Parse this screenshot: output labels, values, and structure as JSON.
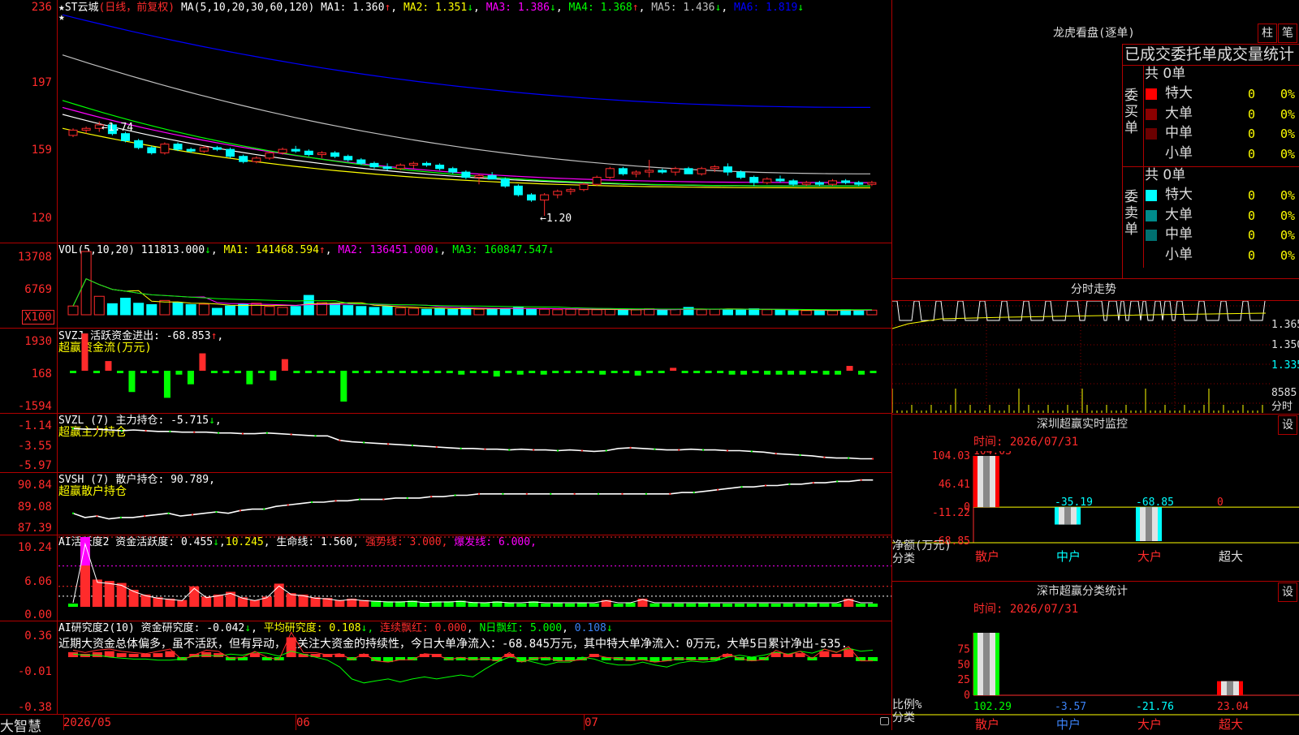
{
  "main": {
    "title": "ST云城",
    "mode": "(日线，前复权)",
    "ma_label": "MA(5,10,20,30,60,120)",
    "ma": [
      {
        "name": "MA1:",
        "value": "1.360",
        "arrow": "↑",
        "color": "#ffffff"
      },
      {
        "name": "MA2:",
        "value": "1.351",
        "arrow": "↓",
        "color": "#ffff00"
      },
      {
        "name": "MA3:",
        "value": "1.386",
        "arrow": "↓",
        "color": "#ff00ff"
      },
      {
        "name": "MA4:",
        "value": "1.368",
        "arrow": "↑",
        "color": "#00ff00"
      },
      {
        "name": "MA5:",
        "value": "1.436",
        "arrow": "↓",
        "color": "#c0c0c0"
      },
      {
        "name": "MA6:",
        "value": "1.819",
        "arrow": "↓",
        "color": "#0000ff"
      }
    ],
    "yticks": [
      "236",
      "197",
      "159",
      "120"
    ],
    "annot_high": "←1.74",
    "annot_low": "←1.20",
    "ohlc": [
      [
        1.66,
        1.7,
        1.65,
        1.69
      ],
      [
        1.69,
        1.71,
        1.67,
        1.7
      ],
      [
        1.7,
        1.74,
        1.68,
        1.72
      ],
      [
        1.72,
        1.73,
        1.66,
        1.67
      ],
      [
        1.67,
        1.68,
        1.62,
        1.63
      ],
      [
        1.63,
        1.64,
        1.58,
        1.59
      ],
      [
        1.59,
        1.6,
        1.55,
        1.56
      ],
      [
        1.56,
        1.62,
        1.55,
        1.61
      ],
      [
        1.61,
        1.62,
        1.57,
        1.58
      ],
      [
        1.58,
        1.59,
        1.56,
        1.57
      ],
      [
        1.57,
        1.6,
        1.56,
        1.59
      ],
      [
        1.59,
        1.6,
        1.57,
        1.58
      ],
      [
        1.58,
        1.59,
        1.53,
        1.54
      ],
      [
        1.54,
        1.55,
        1.5,
        1.51
      ],
      [
        1.51,
        1.54,
        1.5,
        1.53
      ],
      [
        1.53,
        1.57,
        1.52,
        1.56
      ],
      [
        1.56,
        1.59,
        1.55,
        1.58
      ],
      [
        1.58,
        1.6,
        1.56,
        1.57
      ],
      [
        1.57,
        1.58,
        1.54,
        1.55
      ],
      [
        1.55,
        1.57,
        1.53,
        1.56
      ],
      [
        1.56,
        1.57,
        1.53,
        1.54
      ],
      [
        1.54,
        1.55,
        1.51,
        1.52
      ],
      [
        1.52,
        1.53,
        1.49,
        1.5
      ],
      [
        1.5,
        1.51,
        1.47,
        1.48
      ],
      [
        1.48,
        1.5,
        1.46,
        1.47
      ],
      [
        1.47,
        1.5,
        1.46,
        1.49
      ],
      [
        1.49,
        1.51,
        1.47,
        1.5
      ],
      [
        1.5,
        1.51,
        1.48,
        1.49
      ],
      [
        1.49,
        1.5,
        1.46,
        1.47
      ],
      [
        1.47,
        1.48,
        1.44,
        1.45
      ],
      [
        1.45,
        1.46,
        1.41,
        1.42
      ],
      [
        1.42,
        1.44,
        1.38,
        1.43
      ],
      [
        1.43,
        1.45,
        1.41,
        1.41
      ],
      [
        1.41,
        1.42,
        1.36,
        1.37
      ],
      [
        1.37,
        1.38,
        1.31,
        1.32
      ],
      [
        1.32,
        1.33,
        1.28,
        1.29
      ],
      [
        1.29,
        1.33,
        1.2,
        1.32
      ],
      [
        1.32,
        1.35,
        1.3,
        1.34
      ],
      [
        1.34,
        1.36,
        1.32,
        1.35
      ],
      [
        1.35,
        1.39,
        1.34,
        1.38
      ],
      [
        1.38,
        1.43,
        1.37,
        1.42
      ],
      [
        1.42,
        1.48,
        1.41,
        1.47
      ],
      [
        1.47,
        1.48,
        1.43,
        1.44
      ],
      [
        1.44,
        1.46,
        1.42,
        1.45
      ],
      [
        1.45,
        1.52,
        1.42,
        1.46
      ],
      [
        1.46,
        1.47,
        1.44,
        1.45
      ],
      [
        1.45,
        1.48,
        1.43,
        1.47
      ],
      [
        1.47,
        1.48,
        1.44,
        1.44
      ],
      [
        1.44,
        1.48,
        1.43,
        1.47
      ],
      [
        1.47,
        1.49,
        1.45,
        1.48
      ],
      [
        1.48,
        1.5,
        1.43,
        1.45
      ],
      [
        1.45,
        1.46,
        1.41,
        1.42
      ],
      [
        1.42,
        1.43,
        1.37,
        1.39
      ],
      [
        1.39,
        1.42,
        1.38,
        1.41
      ],
      [
        1.41,
        1.43,
        1.39,
        1.4
      ],
      [
        1.4,
        1.41,
        1.37,
        1.38
      ],
      [
        1.38,
        1.4,
        1.37,
        1.39
      ],
      [
        1.39,
        1.4,
        1.37,
        1.38
      ],
      [
        1.38,
        1.41,
        1.37,
        1.4
      ],
      [
        1.4,
        1.41,
        1.38,
        1.39
      ],
      [
        1.39,
        1.4,
        1.37,
        1.38
      ],
      [
        1.38,
        1.4,
        1.37,
        1.39
      ]
    ],
    "ma_lines": [
      {
        "color": "#ffffff",
        "start": 1.78,
        "end": 1.37
      },
      {
        "color": "#ffff00",
        "start": 1.7,
        "end": 1.36
      },
      {
        "color": "#ff00ff",
        "start": 1.82,
        "end": 1.39
      },
      {
        "color": "#00ff00",
        "start": 1.86,
        "end": 1.37
      },
      {
        "color": "#c0c0c0",
        "start": 2.12,
        "end": 1.44
      },
      {
        "color": "#0000ff",
        "start": 2.35,
        "end": 1.82
      }
    ]
  },
  "vol": {
    "label": "VOL(5,10,20)",
    "value": "111813.000",
    "arrow": "↓",
    "ma": [
      {
        "name": "MA1:",
        "value": "141468.594",
        "arrow": "↑",
        "color": "#ffff00"
      },
      {
        "name": "MA2:",
        "value": "136451.000",
        "arrow": "↓",
        "color": "#ff00ff"
      },
      {
        "name": "MA3:",
        "value": "160847.547",
        "arrow": "↓",
        "color": "#00ff00"
      }
    ],
    "yticks": [
      "13708",
      "6769"
    ],
    "unit": "X100",
    "values": [
      1.9,
      13.7,
      4.0,
      2.4,
      3.6,
      2.5,
      2.2,
      3.1,
      2.6,
      2.2,
      2.3,
      1.4,
      1.9,
      2.3,
      2.5,
      1.8,
      1.6,
      1.8,
      4.2,
      2.6,
      2.4,
      2.0,
      1.8,
      1.6,
      1.8,
      1.5,
      1.4,
      1.2,
      1.3,
      1.2,
      1.5,
      1.2,
      1.3,
      1.4,
      1.6,
      1.3,
      1.2,
      1.1,
      1.2,
      1.1,
      1.1,
      1.2,
      1.0,
      1.1,
      1.3,
      1.0,
      1.2,
      1.6,
      1.1,
      1.2,
      1.2,
      1.1,
      1.3,
      1.1,
      1.0,
      0.9,
      0.9,
      1.0,
      0.9,
      1.1,
      1.0,
      1.0
    ]
  },
  "svzj": {
    "label": "SVZJ  活跃资金进出:",
    "value": "-68.853",
    "arrow": "↑",
    "subtitle": "超赢资金流(万元)",
    "yticks": [
      "1930",
      "168",
      "-1594"
    ],
    "values": [
      -30,
      1930,
      -60,
      500,
      -100,
      -1100,
      -80,
      -120,
      -1400,
      -200,
      -700,
      900,
      -100,
      -50,
      -100,
      -700,
      -60,
      -500,
      600,
      -80,
      -120,
      -60,
      -50,
      -1594,
      -60,
      -50,
      -60,
      -80,
      -40,
      -60,
      -50,
      -40,
      -80,
      -200,
      -40,
      -60,
      -300,
      -60,
      -200,
      -50,
      -200,
      -40,
      -40,
      -50,
      -40,
      -200,
      -30,
      -40,
      -250,
      -30,
      -40,
      150,
      -60,
      -40,
      -40,
      -40,
      -200,
      -200,
      -30,
      -200,
      -200,
      -200,
      -200,
      -30,
      -200,
      -200,
      250,
      -200,
      -50
    ]
  },
  "svzl": {
    "label": "SVZL (7) 主力持仓:",
    "value": "-5.715",
    "arrow": "↓",
    "subtitle": "超赢主力持仓",
    "yticks": [
      "-1.14",
      "-3.55",
      "-5.97"
    ],
    "series": [
      -1.6,
      -1.7,
      -1.7,
      -1.8,
      -1.9,
      -1.8,
      -1.9,
      -2.0,
      -2.0,
      -2.1,
      -2.1,
      -2.1,
      -2.2,
      -2.2,
      -2.3,
      -2.3,
      -2.2,
      -2.3,
      -2.4,
      -2.5,
      -2.6,
      -2.6,
      -3.2,
      -3.4,
      -3.5,
      -3.6,
      -3.7,
      -3.8,
      -3.9,
      -4.0,
      -4.1,
      -4.2,
      -4.3,
      -4.3,
      -4.4,
      -4.4,
      -4.5,
      -4.4,
      -4.5,
      -4.5,
      -4.6,
      -4.5,
      -4.6,
      -4.7,
      -4.6,
      -4.3,
      -4.2,
      -4.3,
      -4.4,
      -4.5,
      -4.5,
      -4.4,
      -4.5,
      -4.5,
      -4.6,
      -4.6,
      -4.7,
      -4.8,
      -5.0,
      -5.1,
      -5.2,
      -5.3,
      -5.5,
      -5.6,
      -5.6,
      -5.7,
      -5.7
    ]
  },
  "svsh": {
    "label": "SVSH (7) 散户持仓:",
    "value": "90.789",
    "arrow": "",
    "subtitle": "超赢散户持仓",
    "yticks": [
      "90.84",
      "89.08",
      "87.39"
    ],
    "series": [
      88.4,
      88.1,
      88.2,
      88.0,
      88.1,
      88.1,
      88.2,
      88.3,
      88.4,
      88.2,
      88.3,
      88.4,
      88.5,
      88.4,
      88.6,
      88.7,
      88.7,
      88.9,
      89.0,
      89.1,
      89.2,
      89.2,
      89.3,
      89.3,
      89.4,
      89.4,
      89.4,
      89.5,
      89.5,
      89.5,
      89.6,
      89.6,
      89.7,
      89.7,
      89.8,
      89.8,
      89.8,
      89.8,
      89.8,
      89.8,
      89.8,
      89.8,
      89.8,
      89.8,
      89.8,
      89.8,
      89.8,
      89.8,
      89.8,
      89.8,
      89.8,
      89.9,
      89.9,
      90.0,
      90.1,
      90.2,
      90.3,
      90.3,
      90.4,
      90.4,
      90.5,
      90.5,
      90.6,
      90.6,
      90.7,
      90.7,
      90.8,
      90.8
    ]
  },
  "ai1": {
    "label": "AI活跃度2 资金活跃度:",
    "value": "0.455",
    "arrow": "↓",
    "v2": "10.245",
    "life_label": "生命线:",
    "life_value": "1.560",
    "strong_label": "强势线:",
    "strong_value": "3.000",
    "burst_label": "爆发线:",
    "burst_value": "6.000",
    "yticks": [
      "10.24",
      "6.06",
      "0.00"
    ],
    "values": [
      0.4,
      10.24,
      4.0,
      3.8,
      3.5,
      2.5,
      1.8,
      1.4,
      1.2,
      1.0,
      3.0,
      1.5,
      1.8,
      2.2,
      1.4,
      1.0,
      1.5,
      3.4,
      2.0,
      1.8,
      1.4,
      1.3,
      1.0,
      1.2,
      1.0,
      0.9,
      0.8,
      0.8,
      0.9,
      0.7,
      0.8,
      0.8,
      0.9,
      0.7,
      0.6,
      0.8,
      0.6,
      0.5,
      0.8,
      0.5,
      0.6,
      0.5,
      0.6,
      0.5,
      1.0,
      0.4,
      0.6,
      1.2,
      0.5,
      0.5,
      0.5,
      0.5,
      0.6,
      0.5,
      0.4,
      0.4,
      0.4,
      0.5,
      0.4,
      0.5,
      0.4,
      0.6,
      0.5,
      0.5,
      1.2,
      0.4,
      0.45
    ]
  },
  "ai2": {
    "label": "AI研究度2(10) 资金研究度:",
    "value": "-0.042",
    "arrow": "↓",
    "avg_label": "平均研究度:",
    "avg_value": "0.108",
    "lian_label": "连续飘红:",
    "lian_value": "0.000",
    "n_label": "N日飘红:",
    "n_value": "5.000",
    "last_value": "0.108",
    "comment": "近期大资金总体偏多，虽不活跃，但有异动，宜关注大资金的持续性，今日大单净流入：-68.845万元，其中特大单净流入：0万元，大单5日累计净出-535.",
    "yticks": [
      "0.36",
      "-0.01",
      "-0.38"
    ],
    "values": [
      0.05,
      0.03,
      0.05,
      0.06,
      0.04,
      0.03,
      0.02,
      0.04,
      0.06,
      -0.03,
      0.01,
      0.05,
      0.04,
      -0.02,
      -0.01,
      0.04,
      -0.01,
      -0.03,
      0.2,
      0.03,
      0.03,
      0.01,
      0.02,
      -0.03,
      0.02,
      -0.04,
      -0.05,
      -0.03,
      -0.03,
      0.02,
      0.01,
      -0.03,
      -0.01,
      -0.03,
      -0.02,
      -0.04,
      0.03,
      -0.05,
      -0.02,
      -0.01,
      -0.04,
      -0.04,
      -0.03,
      0.01,
      -0.01,
      -0.02,
      -0.04,
      -0.03,
      -0.05,
      -0.04,
      -0.02,
      -0.03,
      -0.03,
      -0.02,
      0.02,
      -0.02,
      -0.04,
      -0.03,
      0.05,
      0.01,
      0.04,
      -0.02,
      0.06,
      0.03,
      0.08,
      -0.04,
      -0.04
    ]
  },
  "dates": [
    "2026/05",
    "06",
    "07"
  ],
  "brand": "大智慧",
  "right": {
    "dragon_title": "龙虎看盘(逐单)",
    "btn_zhu": "柱",
    "btn_bi": "笔",
    "stat_title": "已成交委托单成交量统计",
    "buy_label": "委买单",
    "sell_label": "委卖单",
    "buy_total": "共 0单",
    "sell_total": "共 0单",
    "buy_rows": [
      {
        "name": "特大",
        "count": "0",
        "pct": "0%",
        "color": "#ff0000"
      },
      {
        "name": "大单",
        "count": "0",
        "pct": "0%",
        "color": "#8b0000"
      },
      {
        "name": "中单",
        "count": "0",
        "pct": "0%",
        "color": "#6b0000"
      },
      {
        "name": "小单",
        "count": "0",
        "pct": "0%",
        "color": ""
      }
    ],
    "sell_rows": [
      {
        "name": "特大",
        "count": "0",
        "pct": "0%",
        "color": "#00ffff"
      },
      {
        "name": "大单",
        "count": "0",
        "pct": "0%",
        "color": "#008b8b"
      },
      {
        "name": "中单",
        "count": "0",
        "pct": "0%",
        "color": "#007070"
      },
      {
        "name": "小单",
        "count": "0",
        "pct": "0%",
        "color": ""
      }
    ],
    "fenshi_title": "分时走势",
    "fenshi_prices": [
      "1.365",
      "1.350",
      "1.335"
    ],
    "fenshi_vol": "8585",
    "fenshi_unit": "分时",
    "shenzhen_title": "深圳超赢实时监控",
    "shenzhen_btn": "设",
    "sz_time": "时间: 2026/07/31",
    "sz_yticks": [
      "104.03",
      "46.41",
      "0",
      "-11.22",
      "-68.85"
    ],
    "sz_values": [
      {
        "cat": "散户",
        "value": 104.03,
        "label": "104.03"
      },
      {
        "cat": "中户",
        "value": -35.19,
        "label": "-35.19"
      },
      {
        "cat": "大户",
        "value": -68.85,
        "label": "-68.85"
      },
      {
        "cat": "超大",
        "value": 0,
        "label": "0"
      }
    ],
    "sz_ylabel": "净额(万元)",
    "sz_xlabel": "分类",
    "class_title": "深市超赢分类统计",
    "class_btn": "设",
    "cl_time": "时间: 2026/07/31",
    "cl_yticks": [
      "75",
      "50",
      "25",
      "0"
    ],
    "cl_values": [
      {
        "cat": "散户",
        "value": 102.29,
        "label": "102.29"
      },
      {
        "cat": "中户",
        "value": -3.57,
        "label": "-3.57"
      },
      {
        "cat": "大户",
        "value": -21.76,
        "label": "-21.76"
      },
      {
        "cat": "超大",
        "value": 23.04,
        "label": "23.04"
      }
    ],
    "cl_ylabel": "比例%",
    "cl_xlabel": "分类"
  }
}
